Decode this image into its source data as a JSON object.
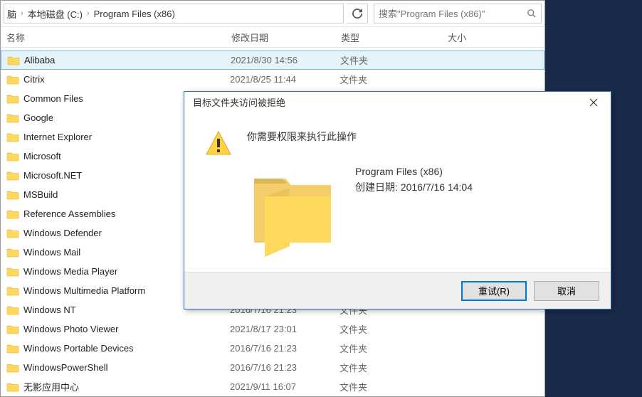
{
  "breadcrumb": {
    "seg1": "脑",
    "seg2": "本地磁盘 (C:)",
    "seg3": "Program Files (x86)"
  },
  "search": {
    "placeholder": "搜索\"Program Files (x86)\""
  },
  "columns": {
    "name": "名称",
    "date": "修改日期",
    "type": "类型",
    "size": "大小"
  },
  "files": [
    {
      "name": "Alibaba",
      "date": "2021/8/30 14:56",
      "type": "文件夹",
      "selected": "full"
    },
    {
      "name": "Citrix",
      "date": "2021/8/25 11:44",
      "type": "文件夹"
    },
    {
      "name": "Common Files",
      "date": "",
      "type": ""
    },
    {
      "name": "Google",
      "date": "",
      "type": ""
    },
    {
      "name": "Internet Explorer",
      "date": "",
      "type": ""
    },
    {
      "name": "Microsoft",
      "date": "",
      "type": ""
    },
    {
      "name": "Microsoft.NET",
      "date": "",
      "type": ""
    },
    {
      "name": "MSBuild",
      "date": "",
      "type": ""
    },
    {
      "name": "Reference Assemblies",
      "date": "",
      "type": ""
    },
    {
      "name": "Windows Defender",
      "date": "",
      "type": ""
    },
    {
      "name": "Windows Mail",
      "date": "",
      "type": ""
    },
    {
      "name": "Windows Media Player",
      "date": "",
      "type": ""
    },
    {
      "name": "Windows Multimedia Platform",
      "date": "",
      "type": ""
    },
    {
      "name": "Windows NT",
      "date": "2016/7/16 21:23",
      "type": "文件夹"
    },
    {
      "name": "Windows Photo Viewer",
      "date": "2021/8/17 23:01",
      "type": "文件夹"
    },
    {
      "name": "Windows Portable Devices",
      "date": "2016/7/16 21:23",
      "type": "文件夹"
    },
    {
      "name": "WindowsPowerShell",
      "date": "2016/7/16 21:23",
      "type": "文件夹"
    },
    {
      "name": "无影应用中心",
      "date": "2021/9/11 16:07",
      "type": "文件夹"
    }
  ],
  "dialog": {
    "title": "目标文件夹访问被拒绝",
    "message": "你需要权限来执行此操作",
    "folder_name": "Program Files (x86)",
    "created_label": "创建日期: 2016/7/16 14:04",
    "retry": "重试(R)",
    "cancel": "取消"
  }
}
